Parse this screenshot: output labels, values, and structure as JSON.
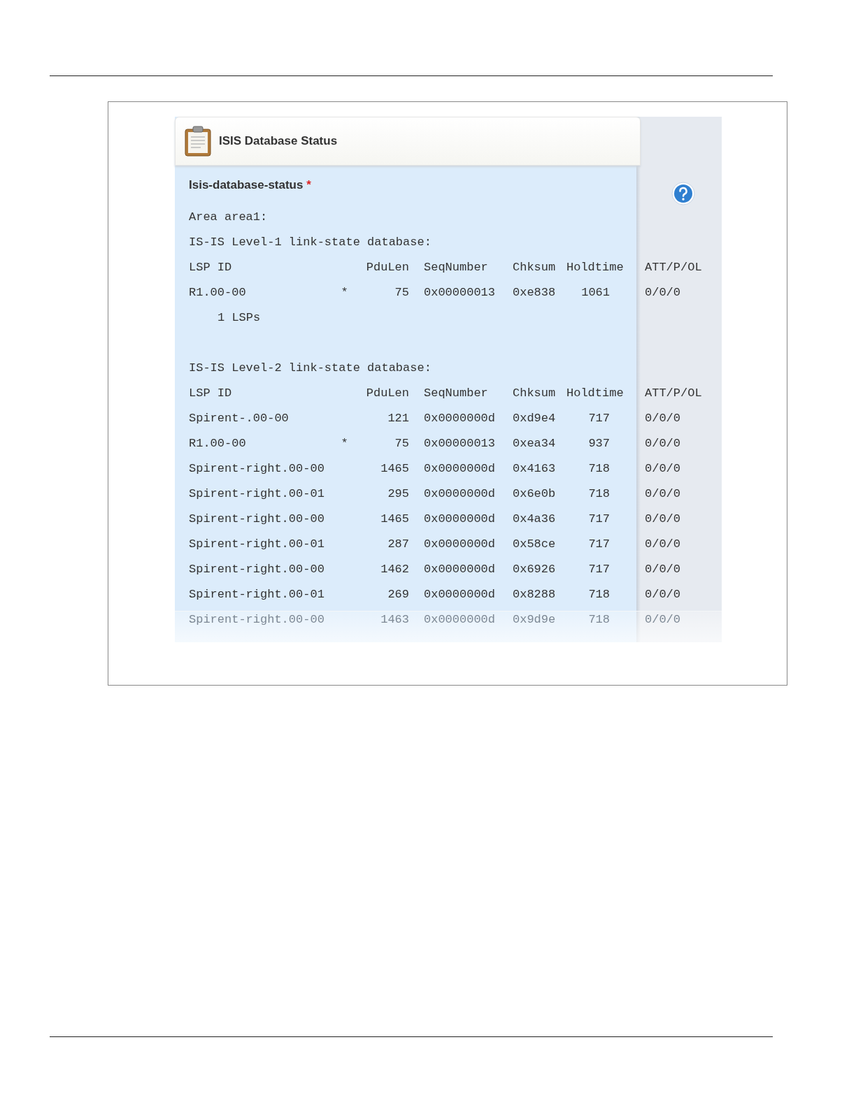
{
  "header": {
    "title": "ISIS Database Status"
  },
  "section": {
    "title": "Isis-database-status",
    "required_mark": "*"
  },
  "output": {
    "area_line": "Area area1:",
    "databases": [
      {
        "title": "IS-IS Level-1 link-state database:",
        "columns": [
          "LSP ID",
          "PduLen",
          "SeqNumber",
          "Chksum",
          "Holdtime",
          "ATT/P/OL"
        ],
        "rows": [
          {
            "lsp_id": "R1.00-00",
            "flag": "*",
            "pdu_len": "75",
            "seq_number": "0x00000013",
            "chksum": "0xe838",
            "holdtime": "1061",
            "att_p_ol": "0/0/0",
            "faded": false
          }
        ],
        "summary": "1 LSPs"
      },
      {
        "title": "IS-IS Level-2 link-state database:",
        "columns": [
          "LSP ID",
          "PduLen",
          "SeqNumber",
          "Chksum",
          "Holdtime",
          "ATT/P/OL"
        ],
        "rows": [
          {
            "lsp_id": "Spirent-.00-00",
            "pdu_len": "121",
            "seq_number": "0x0000000d",
            "chksum": "0xd9e4",
            "holdtime": "717",
            "att_p_ol": "0/0/0",
            "faded": false
          },
          {
            "lsp_id": "R1.00-00",
            "flag": "*",
            "pdu_len": "75",
            "seq_number": "0x00000013",
            "chksum": "0xea34",
            "holdtime": "937",
            "att_p_ol": "0/0/0",
            "faded": false
          },
          {
            "lsp_id": "Spirent-right.00-00",
            "pdu_len": "1465",
            "seq_number": "0x0000000d",
            "chksum": "0x4163",
            "holdtime": "718",
            "att_p_ol": "0/0/0",
            "faded": false
          },
          {
            "lsp_id": "Spirent-right.00-01",
            "pdu_len": "295",
            "seq_number": "0x0000000d",
            "chksum": "0x6e0b",
            "holdtime": "718",
            "att_p_ol": "0/0/0",
            "faded": false
          },
          {
            "lsp_id": "Spirent-right.00-00",
            "pdu_len": "1465",
            "seq_number": "0x0000000d",
            "chksum": "0x4a36",
            "holdtime": "717",
            "att_p_ol": "0/0/0",
            "faded": false
          },
          {
            "lsp_id": "Spirent-right.00-01",
            "pdu_len": "287",
            "seq_number": "0x0000000d",
            "chksum": "0x58ce",
            "holdtime": "717",
            "att_p_ol": "0/0/0",
            "faded": false
          },
          {
            "lsp_id": "Spirent-right.00-00",
            "pdu_len": "1462",
            "seq_number": "0x0000000d",
            "chksum": "0x6926",
            "holdtime": "717",
            "att_p_ol": "0/0/0",
            "faded": false
          },
          {
            "lsp_id": "Spirent-right.00-01",
            "pdu_len": "269",
            "seq_number": "0x0000000d",
            "chksum": "0x8288",
            "holdtime": "718",
            "att_p_ol": "0/0/0",
            "faded": false
          },
          {
            "lsp_id": "Spirent-right.00-00",
            "pdu_len": "1463",
            "seq_number": "0x0000000d",
            "chksum": "0x9d9e",
            "holdtime": "718",
            "att_p_ol": "0/0/0",
            "faded": true
          }
        ]
      }
    ]
  }
}
